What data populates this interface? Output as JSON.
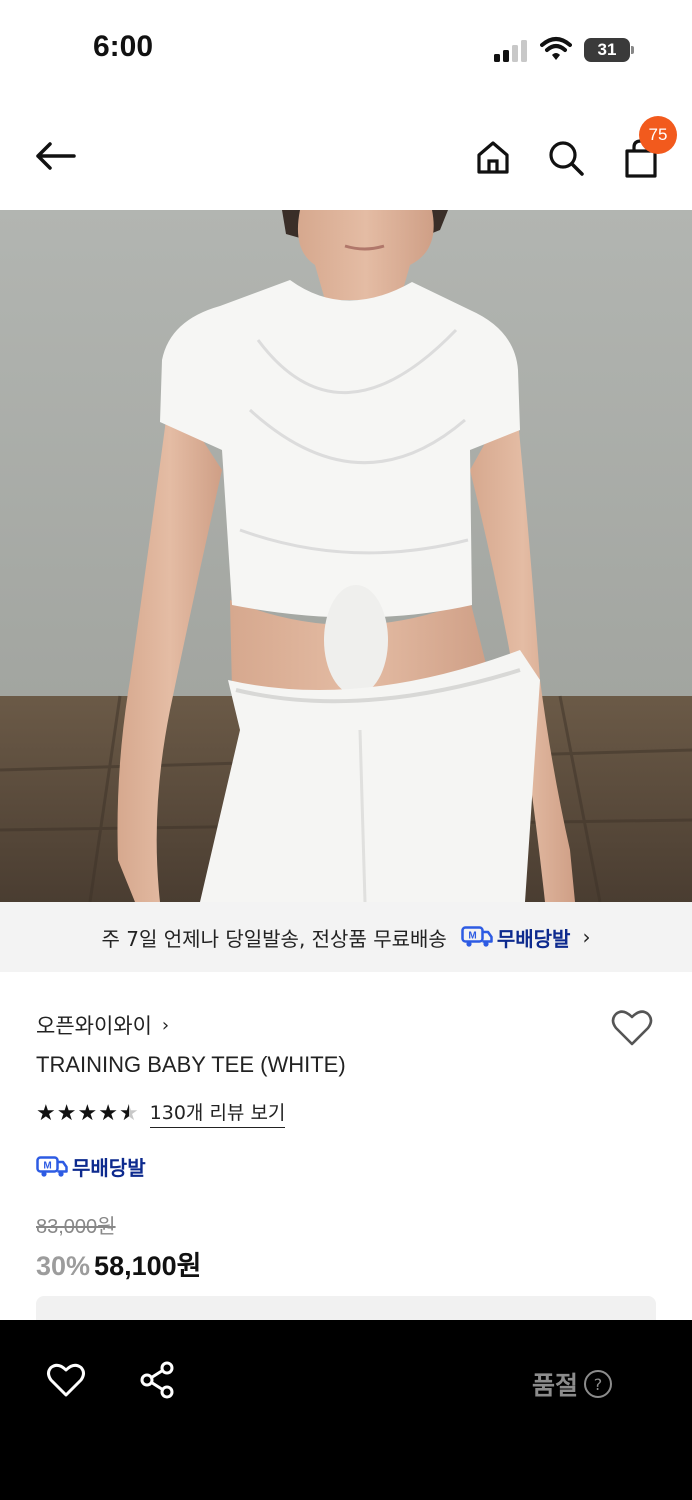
{
  "status_bar": {
    "time": "6:00",
    "battery": "31"
  },
  "nav": {
    "cart_count": "75"
  },
  "delivery_banner": {
    "text": "주 7일 언제나 당일발송, 전상품 무료배송",
    "badge": "무배당발",
    "badge_letter": "M"
  },
  "product": {
    "brand": "오픈와이와이",
    "title": "TRAINING BABY TEE (WHITE)",
    "rating": 4.5,
    "review_link": "130개 리뷰 보기",
    "badge": "무배당발",
    "badge_letter": "M",
    "original_price": "83,000원",
    "discount": "30%",
    "sale_price": "58,100원"
  },
  "bottom_bar": {
    "status": "품절",
    "help": "?"
  },
  "colors": {
    "accent_orange": "#f25a1d",
    "badge_blue": "#0d2a8e",
    "bottom_bg": "#000000"
  }
}
